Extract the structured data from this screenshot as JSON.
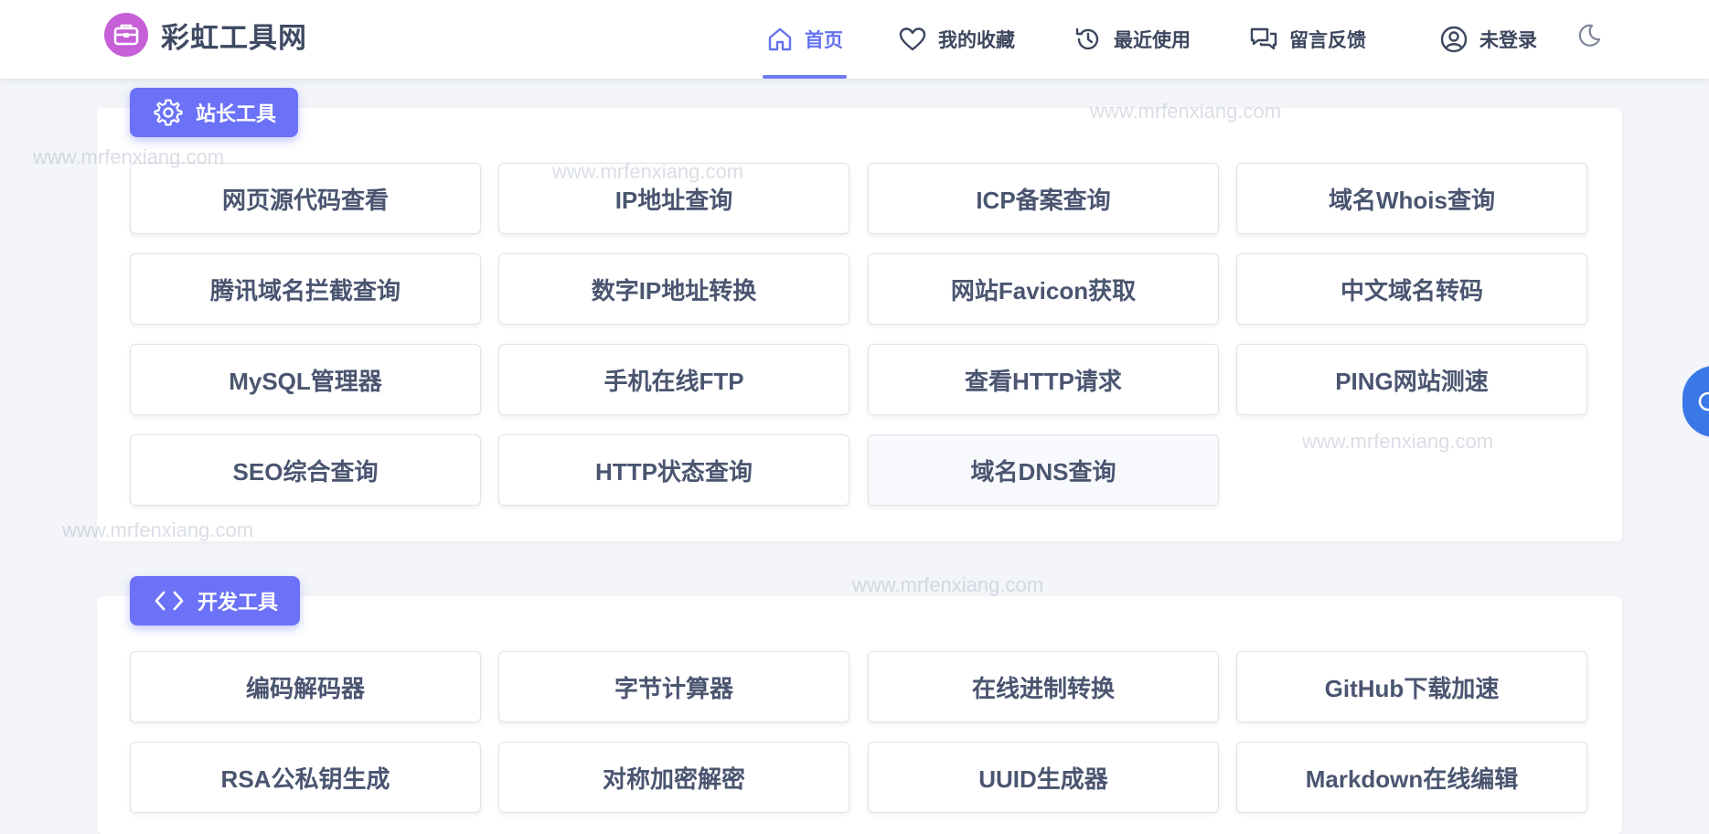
{
  "brand": {
    "name": "彩虹工具网",
    "logo_icon": "briefcase-icon",
    "logo_color": "#c65fd8"
  },
  "nav": {
    "items": [
      {
        "label": "首页",
        "icon": "home-icon",
        "active": true
      },
      {
        "label": "我的收藏",
        "icon": "heart-icon",
        "active": false
      },
      {
        "label": "最近使用",
        "icon": "history-icon",
        "active": false
      },
      {
        "label": "留言反馈",
        "icon": "chat-icon",
        "active": false
      },
      {
        "label": "未登录",
        "icon": "user-icon",
        "active": false
      }
    ],
    "theme_icon": "moon-icon"
  },
  "sections": [
    {
      "title": "站长工具",
      "icon": "gear-icon",
      "tools": [
        "网页源代码查看",
        "IP地址查询",
        "ICP备案查询",
        "域名Whois查询",
        "腾讯域名拦截查询",
        "数字IP地址转换",
        "网站Favicon获取",
        "中文域名转码",
        "MySQL管理器",
        "手机在线FTP",
        "查看HTTP请求",
        "PING网站测速",
        "SEO综合查询",
        "HTTP状态查询",
        "域名DNS查询"
      ]
    },
    {
      "title": "开发工具",
      "icon": "code-icon",
      "tools": [
        "编码解码器",
        "字节计算器",
        "在线进制转换",
        "GitHub下载加速",
        "RSA公私钥生成",
        "对称加密解密",
        "UUID生成器",
        "Markdown在线编辑"
      ]
    }
  ],
  "watermark": "www.mrfenxiang.com",
  "colors": {
    "accent": "#6b72f7",
    "active_nav": "#6472f0",
    "float_button": "#3b78e7"
  }
}
